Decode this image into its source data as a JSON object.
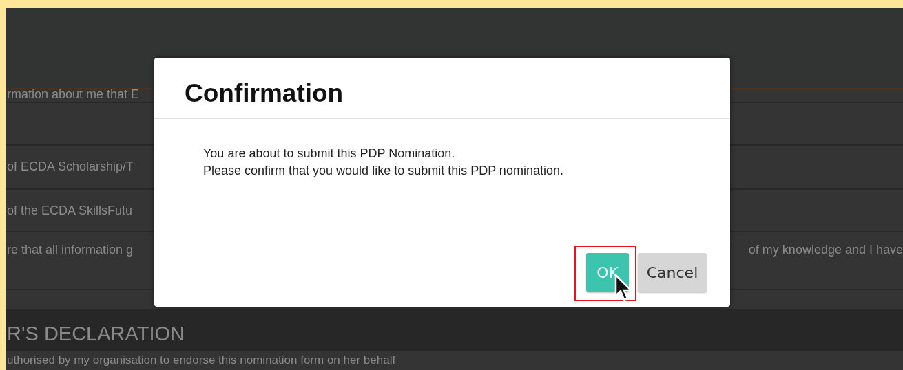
{
  "background_form": {
    "rows": [
      {
        "text": "rmation about me that E"
      },
      {
        "text": ""
      },
      {
        "text": "of ECDA Scholarship/T"
      },
      {
        "text": "of the ECDA SkillsFutu"
      },
      {
        "text": "re that all information g",
        "text_right": "of my knowledge and I have"
      },
      {
        "text": ""
      }
    ],
    "section_heading": "R'S DECLARATION",
    "section_text": "uthorised by my organisation to endorse this nomination form on her behalf"
  },
  "dialog": {
    "title": "Confirmation",
    "message": [
      "You are about to submit this PDP Nomination.",
      "Please confirm that you would like to submit this PDP nomination."
    ],
    "buttons": [
      {
        "label": "OK",
        "kind": "primary",
        "highlighted": true
      },
      {
        "label": "Cancel",
        "kind": "secondary",
        "highlighted": false
      }
    ]
  }
}
